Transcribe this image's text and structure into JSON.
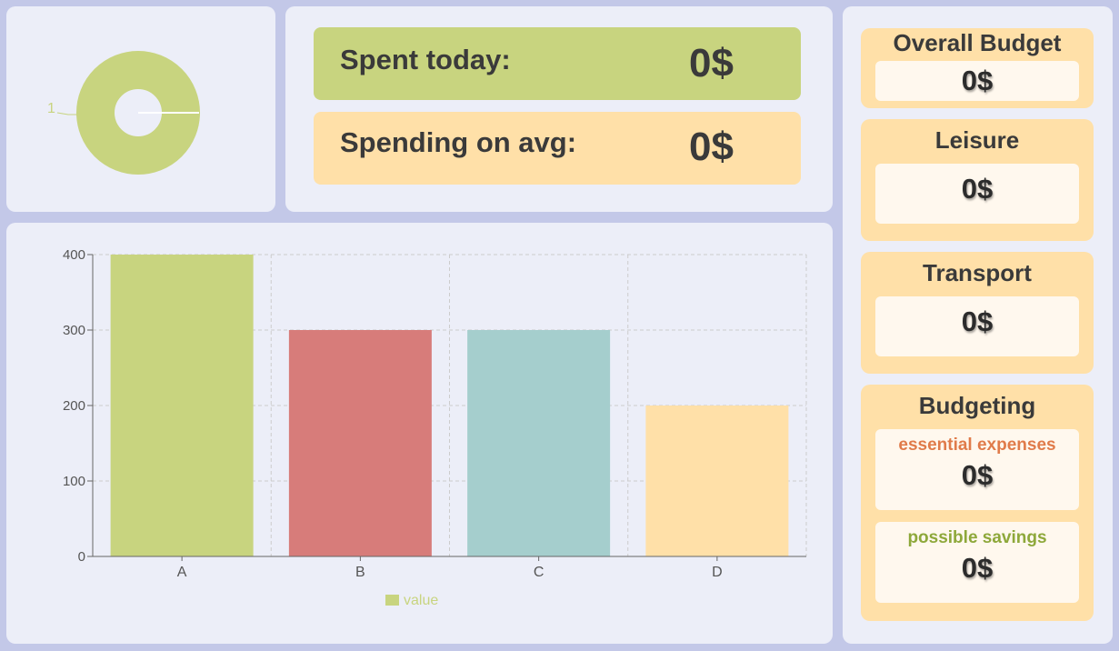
{
  "donut": {
    "label": "1",
    "color": "#c8d47f"
  },
  "stats": {
    "spent_today_label": "Spent today:",
    "spent_today_value": "0$",
    "spending_avg_label": "Spending on avg:",
    "spending_avg_value": "0$"
  },
  "sidebar": {
    "overall": {
      "title": "Overall Budget",
      "value": "0$"
    },
    "leisure": {
      "title": "Leisure",
      "value": "0$"
    },
    "transport": {
      "title": "Transport",
      "value": "0$"
    },
    "budgeting": {
      "title": "Budgeting",
      "essential_label": "essential expenses",
      "essential_value": "0$",
      "savings_label": "possible savings",
      "savings_value": "0$"
    }
  },
  "colors": {
    "green": "#c8d47f",
    "red": "#d77c7a",
    "teal": "#a5cecd",
    "peach": "#ffe0a8",
    "essential": "#e07b4a",
    "savings": "#8ea83a"
  },
  "chart_data": {
    "type": "bar",
    "categories": [
      "A",
      "B",
      "C",
      "D"
    ],
    "series": [
      {
        "name": "value",
        "values": [
          400,
          300,
          300,
          200
        ],
        "colors": [
          "#c8d47f",
          "#d77c7a",
          "#a5cecd",
          "#ffe0a8"
        ]
      }
    ],
    "ylim": [
      0,
      400
    ],
    "yticks": [
      0,
      100,
      200,
      300,
      400
    ],
    "grid": true,
    "legend": "bottom"
  }
}
